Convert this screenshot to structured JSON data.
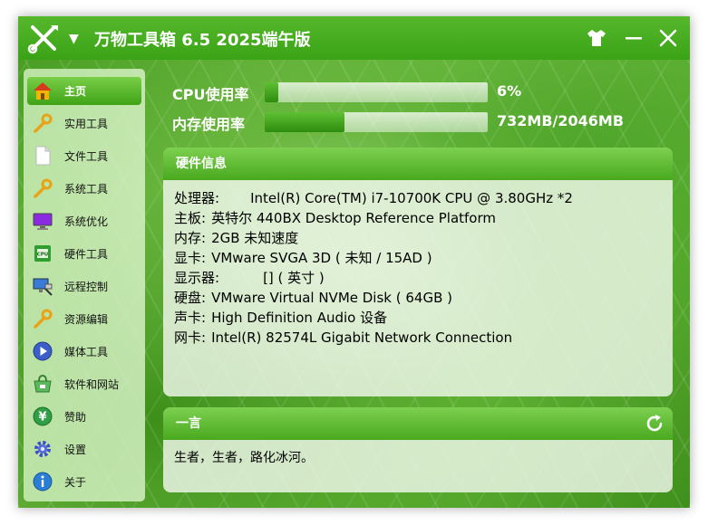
{
  "titlebar": {
    "title": "万物工具箱 6.5 2025端午版",
    "menu_arrow": "▼"
  },
  "sidebar": {
    "items": [
      {
        "label": "主页",
        "icon": "home-icon",
        "active": true
      },
      {
        "label": "实用工具",
        "icon": "wrench-icon",
        "active": false
      },
      {
        "label": "文件工具",
        "icon": "file-icon",
        "active": false
      },
      {
        "label": "系统工具",
        "icon": "wrench-icon",
        "active": false
      },
      {
        "label": "系统优化",
        "icon": "monitor-icon",
        "active": false
      },
      {
        "label": "硬件工具",
        "icon": "cpu-icon",
        "active": false
      },
      {
        "label": "远程控制",
        "icon": "remote-desktop-icon",
        "active": false
      },
      {
        "label": "资源编辑",
        "icon": "wrench-icon",
        "active": false
      },
      {
        "label": "媒体工具",
        "icon": "play-icon",
        "active": false
      },
      {
        "label": "软件和网站",
        "icon": "software-store-icon",
        "active": false
      },
      {
        "label": "赞助",
        "icon": "yen-icon",
        "active": false
      },
      {
        "label": "设置",
        "icon": "gear-icon",
        "active": false
      },
      {
        "label": "关于",
        "icon": "info-icon",
        "active": false
      }
    ]
  },
  "usage": {
    "cpu": {
      "label": "CPU使用率",
      "value": "6%",
      "fraction": 0.06
    },
    "memory": {
      "label": "内存使用率",
      "value": "732MB/2046MB",
      "fraction": 0.358
    }
  },
  "hardware": {
    "title": "硬件信息",
    "rows": [
      {
        "key": "处理器:",
        "value": "Intel(R) Core(TM) i7-10700K CPU @ 3.80GHz *2"
      },
      {
        "key": "主板:",
        "value": "英特尔 440BX Desktop Reference Platform"
      },
      {
        "key": "内存:",
        "value": "2GB 未知速度"
      },
      {
        "key": "显卡:",
        "value": "VMware SVGA 3D ( 未知 / 15AD )"
      },
      {
        "key": "显示器:",
        "value": "[] ( 英寸 )"
      },
      {
        "key": "硬盘:",
        "value": "VMware Virtual NVMe Disk ( 64GB )"
      },
      {
        "key": "声卡:",
        "value": "High Definition Audio 设备"
      },
      {
        "key": "网卡:",
        "value": "Intel(R) 82574L Gigabit Network Connection"
      }
    ]
  },
  "quote": {
    "title": "一言",
    "text": "生者，生者，路化冰河。"
  },
  "colors": {
    "accent": "#3aa315",
    "bar_fill": "#2d8c0e"
  }
}
